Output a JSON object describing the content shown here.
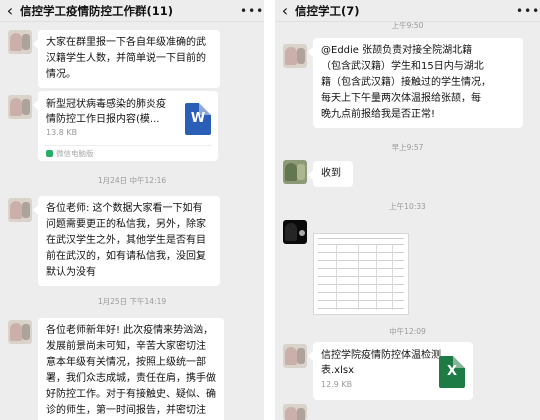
{
  "left": {
    "title": "信控学工疫情防控工作群(11)",
    "back_glyph": "‹",
    "more_glyph": "•••",
    "messages": {
      "m1_lines": [
        "大家在群里报一下各自年级准确的武",
        "汉籍学生人数，并简单说一下目前的",
        "情况。"
      ],
      "file": {
        "name_lines": [
          "新型冠状病毒感染的肺炎疫",
          "情防控工作日报内容(模..."
        ],
        "size": "13.8 KB",
        "icon_letter": "W",
        "source": "微信电脑版"
      },
      "time1": "1月24日 中午12:16",
      "m2_lines": [
        "各位老师: 这个数据大家看一下如有",
        "问题需要更正的私信我，另外，除家",
        "在武汉学生之外，其他学生是否有目",
        "前在武汉的，如有请私信我，没回复",
        "默认为没有"
      ],
      "time2": "1月25日 下午14:19",
      "m3_lines": [
        "各位老师新年好! 此次疫情来势汹汹，",
        "发展前景尚未可知，辛苦大家密切注",
        "意本年级有关情况，按照上级统一部",
        "署，我们众志成城，责任在肩，携手做",
        "好防控工作。对于有接触史、疑似、确",
        "诊的师生，第一时间报告，并密切注"
      ]
    }
  },
  "right": {
    "title": "信控学工(7)",
    "back_glyph": "‹",
    "more_glyph": "•••",
    "top_time": "上午9:50",
    "m1_lines": [
      "@Eddie 张颉负责对接全院湖北籍",
      "（包含武汉籍）学生和15日内与湖北",
      "籍（包含武汉籍）接触过的学生情况，",
      "每天上下午量两次体温报给张颉，每",
      "晚九点前报给我是否正常!"
    ],
    "time1": "早上9:57",
    "m2": "收到",
    "time2": "上午10:33",
    "time3": "中午12:09",
    "file": {
      "name_lines": [
        "信控学院疫情防控体温检测",
        "表.xlsx"
      ],
      "size": "12.9 KB",
      "icon_letter": "X"
    }
  }
}
